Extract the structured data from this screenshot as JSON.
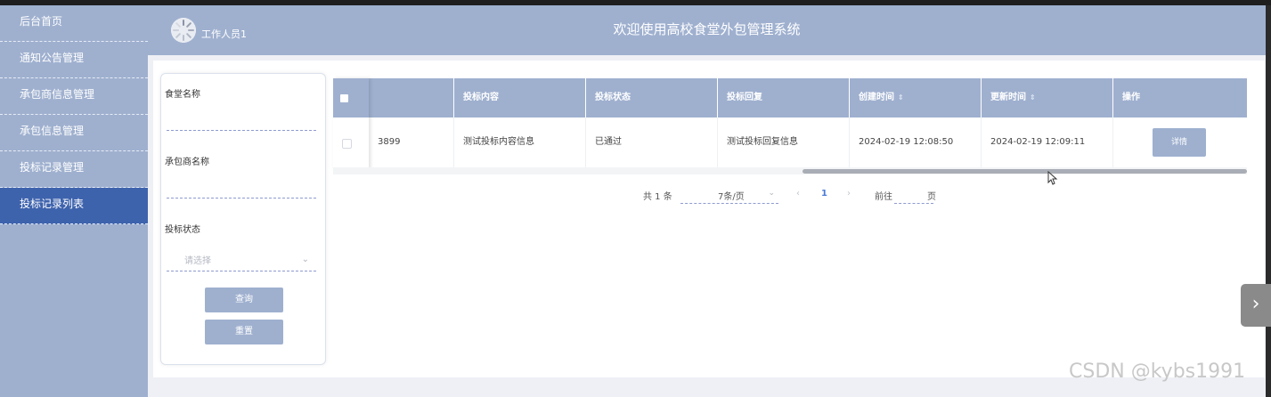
{
  "sidebar": {
    "items": [
      {
        "label": "后台首页"
      },
      {
        "label": "通知公告管理"
      },
      {
        "label": "承包商信息管理"
      },
      {
        "label": "承包信息管理"
      },
      {
        "label": "投标记录管理"
      },
      {
        "label": "投标记录列表"
      }
    ],
    "active_index": 5
  },
  "header": {
    "username": "工作人员1",
    "title": "欢迎使用高校食堂外包管理系统"
  },
  "search": {
    "canteen_label": "食堂名称",
    "contractor_label": "承包商名称",
    "status_label": "投标状态",
    "status_placeholder": "请选择",
    "query_button": "查询",
    "reset_button": "重置"
  },
  "table": {
    "columns": [
      "投标内容",
      "投标状态",
      "投标回复",
      "创建时间",
      "更新时间",
      "操作"
    ],
    "rows": [
      {
        "id_partial": "3899",
        "content": "测试投标内容信息",
        "status": "已通过",
        "reply": "测试投标回复信息",
        "created": "2024-02-19 12:08:50",
        "updated": "2024-02-19 12:09:11",
        "action": "详情"
      }
    ]
  },
  "pager": {
    "total_text": "共 1 条",
    "page_size": "7条/页",
    "current_page": "1",
    "goto_label": "前往",
    "page_suffix": "页"
  },
  "watermark": "CSDN @kybs1991",
  "colors": {
    "primary": "#9fb0cf",
    "active": "#3e63ad",
    "link": "#4a7bd6"
  }
}
